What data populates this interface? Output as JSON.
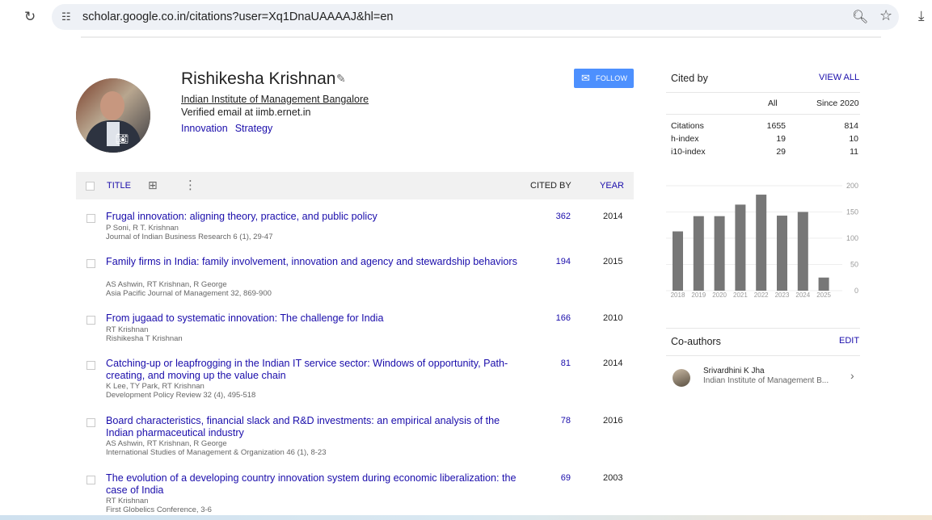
{
  "browser": {
    "url": "scholar.google.co.in/citations?user=Xq1DnaUAAAAJ&hl=en",
    "reload_icon": "reload-icon",
    "site_info_icon": "tune-icon",
    "zoom_icon": "zoom-icon",
    "bookmark_icon": "star-icon",
    "download_icon": "download-icon"
  },
  "profile": {
    "name": "Rishikesha Krishnan",
    "affiliation": "Indian Institute of Management Bangalore",
    "email": "Verified email at iimb.ernet.in",
    "interests": [
      "Innovation",
      "Strategy"
    ],
    "follow_label": "FOLLOW"
  },
  "table": {
    "title_header": "TITLE",
    "cited_header": "CITED BY",
    "year_header": "YEAR",
    "rows": [
      {
        "title": "Frugal innovation: aligning theory, practice, and public policy",
        "authors": "P Soni, R T. Krishnan",
        "venue": "Journal of Indian Business Research 6 (1), 29-47",
        "cited": "362",
        "year": "2014"
      },
      {
        "title": "Family firms in India: family involvement, innovation and agency and stewardship behaviors",
        "authors": "AS Ashwin, RT Krishnan, R George",
        "venue": "Asia Pacific Journal of Management 32, 869-900",
        "cited": "194",
        "year": "2015"
      },
      {
        "title": "From jugaad to systematic innovation: The challenge for India",
        "authors": "RT Krishnan",
        "venue": "Rishikesha T Krishnan",
        "cited": "166",
        "year": "2010"
      },
      {
        "title": "Catching-up or leapfrogging in the Indian IT service sector: Windows of opportunity, Path-creating, and moving up the value chain",
        "authors": "K Lee, TY Park, RT Krishnan",
        "venue": "Development Policy Review 32 (4), 495-518",
        "cited": "81",
        "year": "2014"
      },
      {
        "title": "Board characteristics, financial slack and R&D investments: an empirical analysis of the Indian pharmaceutical industry",
        "authors": "AS Ashwin, RT Krishnan, R George",
        "venue": "International Studies of Management & Organization 46 (1), 8-23",
        "cited": "78",
        "year": "2016"
      },
      {
        "title": "The evolution of a developing country innovation system during economic liberalization: the case of India",
        "authors": "RT Krishnan",
        "venue": "First Globelics Conference, 3-6",
        "cited": "69",
        "year": "2003"
      }
    ]
  },
  "cited_by": {
    "heading": "Cited by",
    "view_all": "VIEW ALL",
    "col_all": "All",
    "col_since": "Since 2020",
    "stats": [
      {
        "label": "Citations",
        "all": "1655",
        "since": "814"
      },
      {
        "label": "h-index",
        "all": "19",
        "since": "10"
      },
      {
        "label": "i10-index",
        "all": "29",
        "since": "11"
      }
    ]
  },
  "chart_data": {
    "type": "bar",
    "categories": [
      "2018",
      "2019",
      "2020",
      "2021",
      "2022",
      "2023",
      "2024",
      "2025"
    ],
    "values": [
      113,
      142,
      142,
      164,
      183,
      143,
      150,
      25
    ],
    "ylim": [
      0,
      200
    ],
    "yticks": [
      "200",
      "150",
      "100",
      "50",
      "0"
    ],
    "bar_color": "#777777"
  },
  "coauthors": {
    "heading": "Co-authors",
    "edit": "EDIT",
    "items": [
      {
        "name": "Srivardhini K Jha",
        "affiliation": "Indian Institute of Management B..."
      }
    ]
  }
}
